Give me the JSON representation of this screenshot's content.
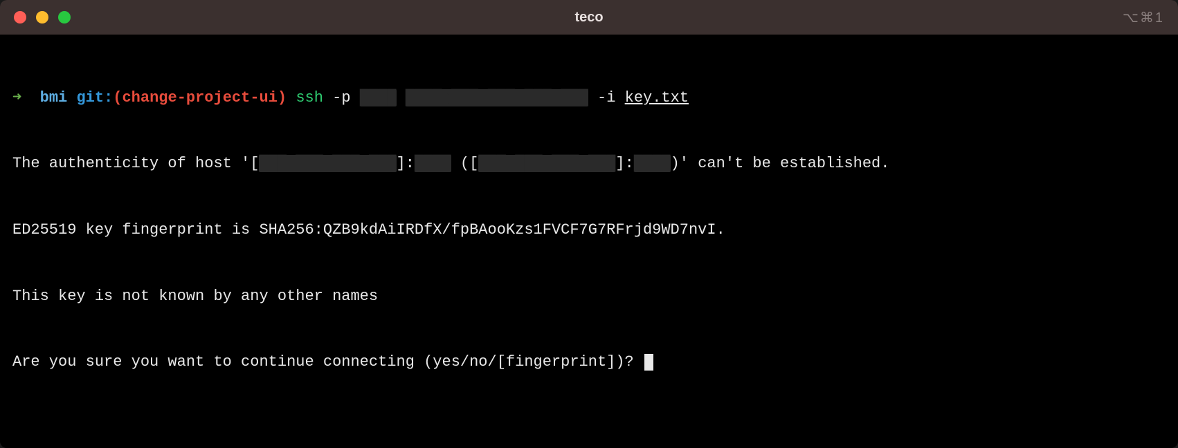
{
  "titlebar": {
    "title": "teco",
    "shortcut": "⌥⌘1"
  },
  "prompt": {
    "arrow": "➜",
    "folder": "bmi",
    "git_label": "git:",
    "paren_open": "(",
    "branch": "change-project-ui",
    "paren_close": ")",
    "command": "ssh",
    "flag_p": "-p",
    "port_redacted": "████",
    "host_redacted": "████@███.███.███.███",
    "flag_i": "-i",
    "keyfile": "key.txt"
  },
  "output": {
    "line1_a": "The authenticity of host '[",
    "line1_redacted1": "███.███.███.███",
    "line1_b": "]:",
    "line1_port1": "████",
    "line1_c": " ([",
    "line1_redacted2": "███.███.███.███",
    "line1_d": "]:",
    "line1_port2": "████",
    "line1_e": ")' can't be established.",
    "line2": "ED25519 key fingerprint is SHA256:QZB9kdAiIRDfX/fpBAooKzs1FVCF7G7RFrjd9WD7nvI.",
    "line3": "This key is not known by any other names",
    "line4": "Are you sure you want to continue connecting (yes/no/[fingerprint])? "
  }
}
